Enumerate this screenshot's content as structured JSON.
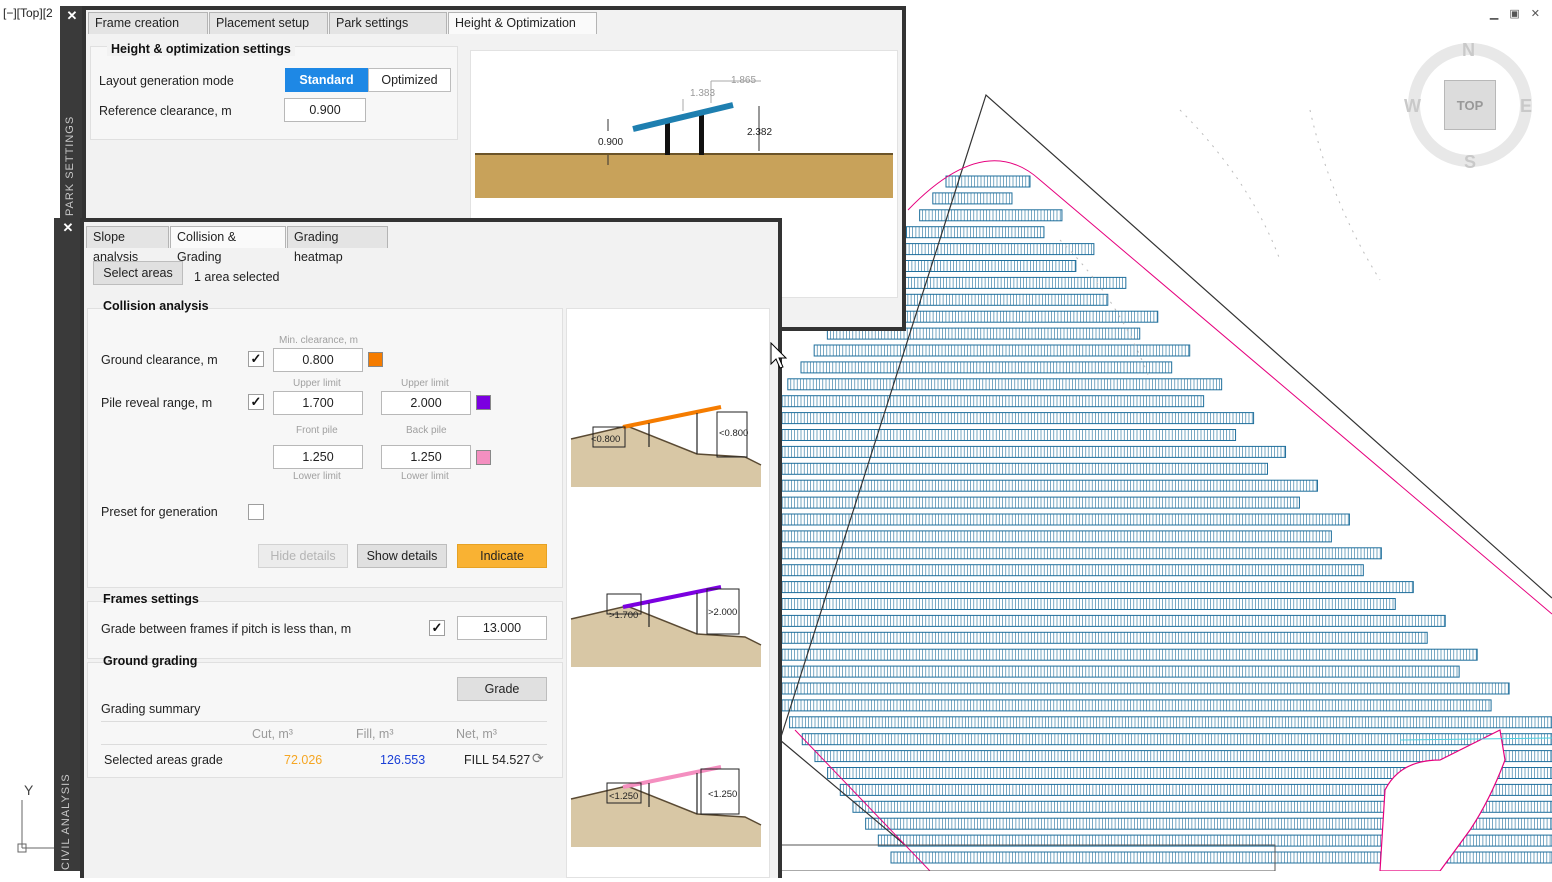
{
  "viewport": {
    "label": "[−][Top][2",
    "window_controls": "▁ ▣ ✕"
  },
  "viewcube": {
    "north": "N",
    "south": "S",
    "east": "E",
    "west": "W",
    "top": "TOP"
  },
  "ucs": {
    "axis_y": "Y"
  },
  "park_settings": {
    "sidebar_title": "PARK SETTINGS",
    "tabs": [
      "Frame creation",
      "Placement setup",
      "Park settings",
      "Height & Optimization"
    ],
    "active_tab": 3,
    "group_title": "Height & optimization settings",
    "mode_label": "Layout generation mode",
    "mode_standard": "Standard",
    "mode_optimized": "Optimized",
    "ref_label": "Reference clearance, m",
    "ref_value": "0.900",
    "diagram": {
      "clearance": "0.900",
      "dim1": "1.383",
      "dim2": "1.865",
      "height": "2.382"
    }
  },
  "civil_analysis": {
    "sidebar_title": "CIVIL ANALYSIS",
    "tabs": [
      "Slope analysis",
      "Collision & Grading",
      "Grading heatmap"
    ],
    "active_tab": 1,
    "select_areas": "Select areas",
    "selected_status": "1 area selected",
    "collision": {
      "title": "Collision analysis",
      "min_clearance_caption": "Min. clearance, m",
      "ground_label": "Ground clearance, m",
      "ground_checked": true,
      "ground_value": "0.800",
      "ground_color": "#f57c00",
      "pile_label": "Pile reveal range, m",
      "pile_checked": true,
      "upper_caption_1": "Upper limit",
      "upper_caption_2": "Upper limit",
      "front_upper": "1.700",
      "back_upper": "2.000",
      "pile_upper_color": "#7b00e0",
      "front_caption": "Front pile",
      "back_caption": "Back pile",
      "front_lower": "1.250",
      "back_lower": "1.250",
      "lower_caption_1": "Lower limit",
      "lower_caption_2": "Lower limit",
      "pile_lower_color": "#f48fc0",
      "preset_label": "Preset for generation",
      "preset_checked": false,
      "hide_details": "Hide details",
      "show_details": "Show details",
      "indicate": "Indicate"
    },
    "frames": {
      "title": "Frames settings",
      "grade_label": "Grade between frames if pitch is less than, m",
      "grade_checked": true,
      "grade_value": "13.000"
    },
    "grading": {
      "title": "Ground grading",
      "grade_button": "Grade",
      "summary_title": "Grading summary",
      "headers": [
        "Cut, m³",
        "Fill, m³",
        "Net, m³"
      ],
      "row_label": "Selected areas grade",
      "cut": "72.026",
      "fill": "126.553",
      "net": "FILL 54.527",
      "cut_color": "#f5a623",
      "fill_color": "#1a3fd6"
    },
    "diagrams": {
      "d1_left": "<0.800",
      "d1_right": "<0.800",
      "d2_left": ">1.700",
      "d2_right": ">2.000",
      "d3_left": "<1.250",
      "d3_right": "<1.250"
    }
  },
  "colors": {
    "module_rows": "#1f6f9c",
    "boundary": "#e6007e",
    "terrain": "#c8a25a",
    "panel_blue": "#1e7fb0"
  }
}
